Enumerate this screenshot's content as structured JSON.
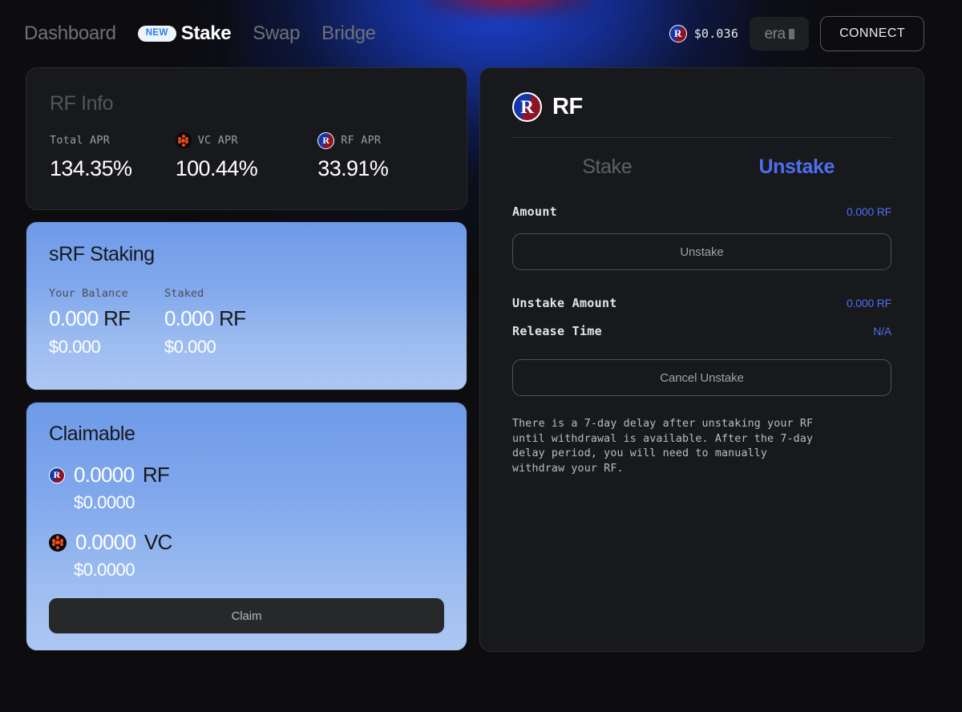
{
  "header": {
    "nav": [
      {
        "label": "Dashboard",
        "active": false
      },
      {
        "label": "Stake",
        "active": true,
        "badge": "NEW"
      },
      {
        "label": "Swap",
        "active": false
      },
      {
        "label": "Bridge",
        "active": false
      }
    ],
    "price": "$0.036",
    "price_icon": "rf-token-icon",
    "network_chip": "era",
    "connect_label": "CONNECT"
  },
  "info_card": {
    "title": "RF Info",
    "stats": [
      {
        "label": "Total APR",
        "value": "134.35%",
        "icon": "none"
      },
      {
        "label": "VC APR",
        "value": "100.44%",
        "icon": "vc-token-icon"
      },
      {
        "label": "RF APR",
        "value": "33.91%",
        "icon": "rf-token-icon"
      }
    ]
  },
  "staking_card": {
    "title": "sRF Staking",
    "columns": [
      {
        "label": "Your Balance",
        "amount": "0.000",
        "symbol": "RF",
        "usd": "$0.000"
      },
      {
        "label": "Staked",
        "amount": "0.000",
        "symbol": "RF",
        "usd": "$0.000"
      }
    ]
  },
  "claimable_card": {
    "title": "Claimable",
    "rows": [
      {
        "icon": "rf-token-icon",
        "amount": "0.0000",
        "symbol": "RF",
        "usd": "$0.0000"
      },
      {
        "icon": "vc-token-icon",
        "amount": "0.0000",
        "symbol": "VC",
        "usd": "$0.0000"
      }
    ],
    "claim_button": "Claim"
  },
  "panel": {
    "token": "RF",
    "token_icon": "rf-token-icon",
    "tabs": [
      {
        "label": "Stake",
        "active": false
      },
      {
        "label": "Unstake",
        "active": true
      }
    ],
    "amount_label": "Amount",
    "amount_value": "0.000 RF",
    "unstake_button": "Unstake",
    "unstake_amount_label": "Unstake Amount",
    "unstake_amount_value": "0.000 RF",
    "release_time_label": "Release Time",
    "release_time_value": "N/A",
    "cancel_button": "Cancel Unstake",
    "note": "There is a 7-day delay after unstaking your RF\nuntil withdrawal is available. After the 7-day\ndelay period, you will need to manually\nwithdraw your RF."
  },
  "colors": {
    "accent_blue": "#4f6ef0",
    "card_blue_top": "#6e9ae8",
    "card_blue_bottom": "#adc7f2",
    "panel_bg": "#18191c",
    "page_bg": "#0d0d0f",
    "vc_orange": "#ef4a14"
  }
}
